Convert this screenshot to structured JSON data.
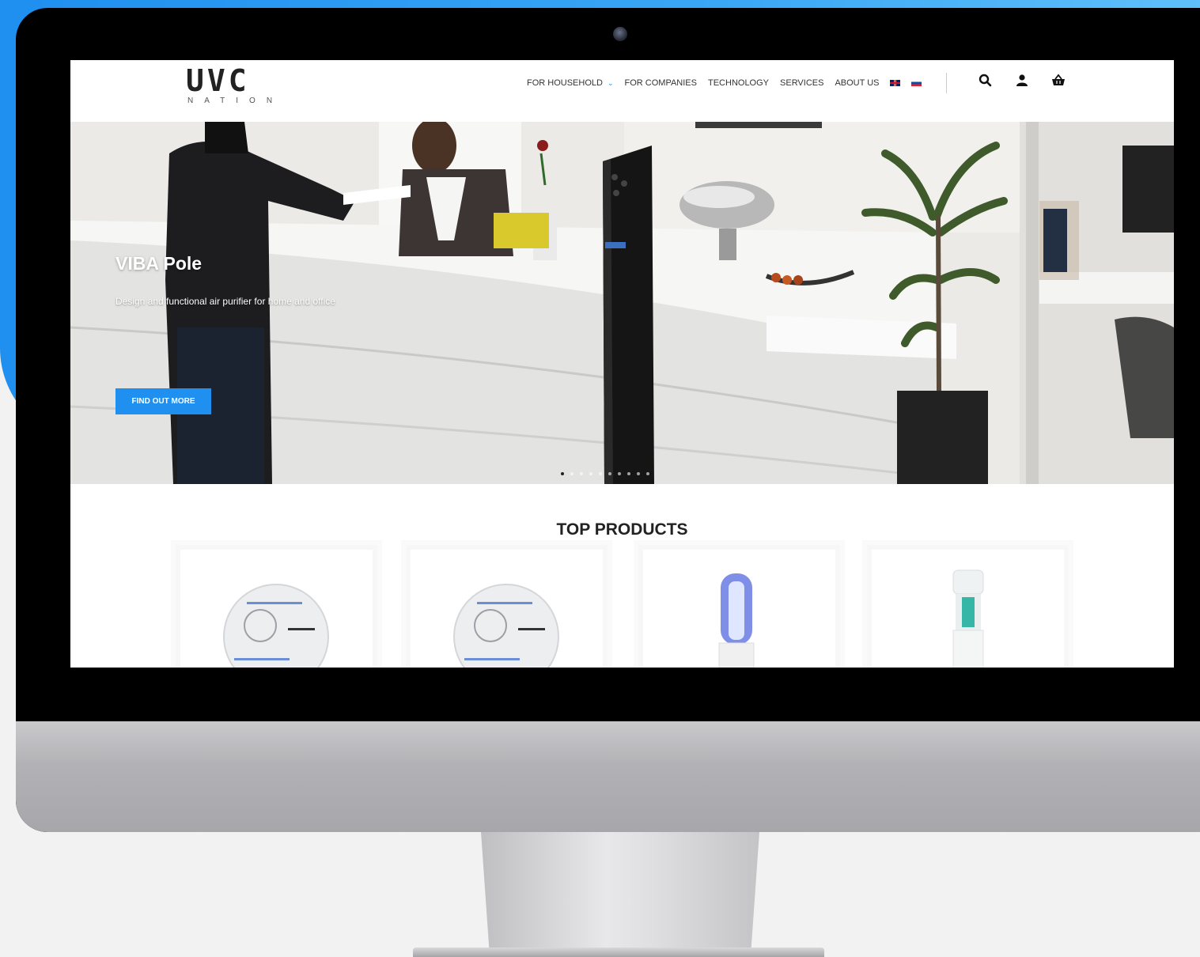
{
  "site": {
    "logo_mark": "UVC",
    "logo_sub": "NATION"
  },
  "nav": {
    "items": [
      {
        "label": "FOR HOUSEHOLD",
        "has_dropdown": true
      },
      {
        "label": "FOR COMPANIES"
      },
      {
        "label": "TECHNOLOGY"
      },
      {
        "label": "SERVICES"
      },
      {
        "label": "ABOUT US"
      }
    ],
    "languages": [
      "en-flag-icon",
      "sk-flag-icon"
    ],
    "icons": [
      "search-icon",
      "user-icon",
      "basket-icon"
    ]
  },
  "hero": {
    "title": "VIBA Pole",
    "subtitle": "Design and functional air purifier for home and office",
    "cta_label": "FIND OUT MORE",
    "slides_count": 10,
    "active_slide": 1
  },
  "products": {
    "title": "TOP PRODUCTS",
    "cards": [
      {
        "image": "round-purifier"
      },
      {
        "image": "round-purifier"
      },
      {
        "image": "uv-lamp-blue"
      },
      {
        "image": "uv-lamp-tower"
      }
    ]
  },
  "colors": {
    "accent": "#1f8ff0",
    "backdrop": "#2d9cf3",
    "text": "#222222"
  }
}
